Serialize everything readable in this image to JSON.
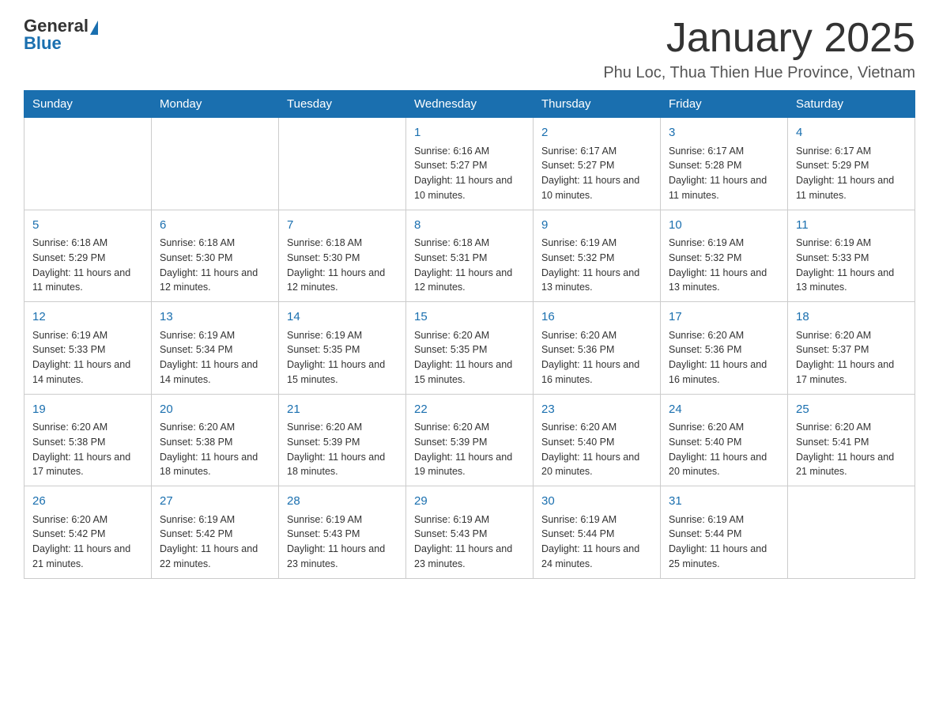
{
  "header": {
    "logo": {
      "general": "General",
      "blue": "Blue"
    },
    "title": "January 2025",
    "subtitle": "Phu Loc, Thua Thien Hue Province, Vietnam"
  },
  "weekdays": [
    "Sunday",
    "Monday",
    "Tuesday",
    "Wednesday",
    "Thursday",
    "Friday",
    "Saturday"
  ],
  "weeks": [
    [
      {
        "day": "",
        "info": ""
      },
      {
        "day": "",
        "info": ""
      },
      {
        "day": "",
        "info": ""
      },
      {
        "day": "1",
        "info": "Sunrise: 6:16 AM\nSunset: 5:27 PM\nDaylight: 11 hours and 10 minutes."
      },
      {
        "day": "2",
        "info": "Sunrise: 6:17 AM\nSunset: 5:27 PM\nDaylight: 11 hours and 10 minutes."
      },
      {
        "day": "3",
        "info": "Sunrise: 6:17 AM\nSunset: 5:28 PM\nDaylight: 11 hours and 11 minutes."
      },
      {
        "day": "4",
        "info": "Sunrise: 6:17 AM\nSunset: 5:29 PM\nDaylight: 11 hours and 11 minutes."
      }
    ],
    [
      {
        "day": "5",
        "info": "Sunrise: 6:18 AM\nSunset: 5:29 PM\nDaylight: 11 hours and 11 minutes."
      },
      {
        "day": "6",
        "info": "Sunrise: 6:18 AM\nSunset: 5:30 PM\nDaylight: 11 hours and 12 minutes."
      },
      {
        "day": "7",
        "info": "Sunrise: 6:18 AM\nSunset: 5:30 PM\nDaylight: 11 hours and 12 minutes."
      },
      {
        "day": "8",
        "info": "Sunrise: 6:18 AM\nSunset: 5:31 PM\nDaylight: 11 hours and 12 minutes."
      },
      {
        "day": "9",
        "info": "Sunrise: 6:19 AM\nSunset: 5:32 PM\nDaylight: 11 hours and 13 minutes."
      },
      {
        "day": "10",
        "info": "Sunrise: 6:19 AM\nSunset: 5:32 PM\nDaylight: 11 hours and 13 minutes."
      },
      {
        "day": "11",
        "info": "Sunrise: 6:19 AM\nSunset: 5:33 PM\nDaylight: 11 hours and 13 minutes."
      }
    ],
    [
      {
        "day": "12",
        "info": "Sunrise: 6:19 AM\nSunset: 5:33 PM\nDaylight: 11 hours and 14 minutes."
      },
      {
        "day": "13",
        "info": "Sunrise: 6:19 AM\nSunset: 5:34 PM\nDaylight: 11 hours and 14 minutes."
      },
      {
        "day": "14",
        "info": "Sunrise: 6:19 AM\nSunset: 5:35 PM\nDaylight: 11 hours and 15 minutes."
      },
      {
        "day": "15",
        "info": "Sunrise: 6:20 AM\nSunset: 5:35 PM\nDaylight: 11 hours and 15 minutes."
      },
      {
        "day": "16",
        "info": "Sunrise: 6:20 AM\nSunset: 5:36 PM\nDaylight: 11 hours and 16 minutes."
      },
      {
        "day": "17",
        "info": "Sunrise: 6:20 AM\nSunset: 5:36 PM\nDaylight: 11 hours and 16 minutes."
      },
      {
        "day": "18",
        "info": "Sunrise: 6:20 AM\nSunset: 5:37 PM\nDaylight: 11 hours and 17 minutes."
      }
    ],
    [
      {
        "day": "19",
        "info": "Sunrise: 6:20 AM\nSunset: 5:38 PM\nDaylight: 11 hours and 17 minutes."
      },
      {
        "day": "20",
        "info": "Sunrise: 6:20 AM\nSunset: 5:38 PM\nDaylight: 11 hours and 18 minutes."
      },
      {
        "day": "21",
        "info": "Sunrise: 6:20 AM\nSunset: 5:39 PM\nDaylight: 11 hours and 18 minutes."
      },
      {
        "day": "22",
        "info": "Sunrise: 6:20 AM\nSunset: 5:39 PM\nDaylight: 11 hours and 19 minutes."
      },
      {
        "day": "23",
        "info": "Sunrise: 6:20 AM\nSunset: 5:40 PM\nDaylight: 11 hours and 20 minutes."
      },
      {
        "day": "24",
        "info": "Sunrise: 6:20 AM\nSunset: 5:40 PM\nDaylight: 11 hours and 20 minutes."
      },
      {
        "day": "25",
        "info": "Sunrise: 6:20 AM\nSunset: 5:41 PM\nDaylight: 11 hours and 21 minutes."
      }
    ],
    [
      {
        "day": "26",
        "info": "Sunrise: 6:20 AM\nSunset: 5:42 PM\nDaylight: 11 hours and 21 minutes."
      },
      {
        "day": "27",
        "info": "Sunrise: 6:19 AM\nSunset: 5:42 PM\nDaylight: 11 hours and 22 minutes."
      },
      {
        "day": "28",
        "info": "Sunrise: 6:19 AM\nSunset: 5:43 PM\nDaylight: 11 hours and 23 minutes."
      },
      {
        "day": "29",
        "info": "Sunrise: 6:19 AM\nSunset: 5:43 PM\nDaylight: 11 hours and 23 minutes."
      },
      {
        "day": "30",
        "info": "Sunrise: 6:19 AM\nSunset: 5:44 PM\nDaylight: 11 hours and 24 minutes."
      },
      {
        "day": "31",
        "info": "Sunrise: 6:19 AM\nSunset: 5:44 PM\nDaylight: 11 hours and 25 minutes."
      },
      {
        "day": "",
        "info": ""
      }
    ]
  ]
}
